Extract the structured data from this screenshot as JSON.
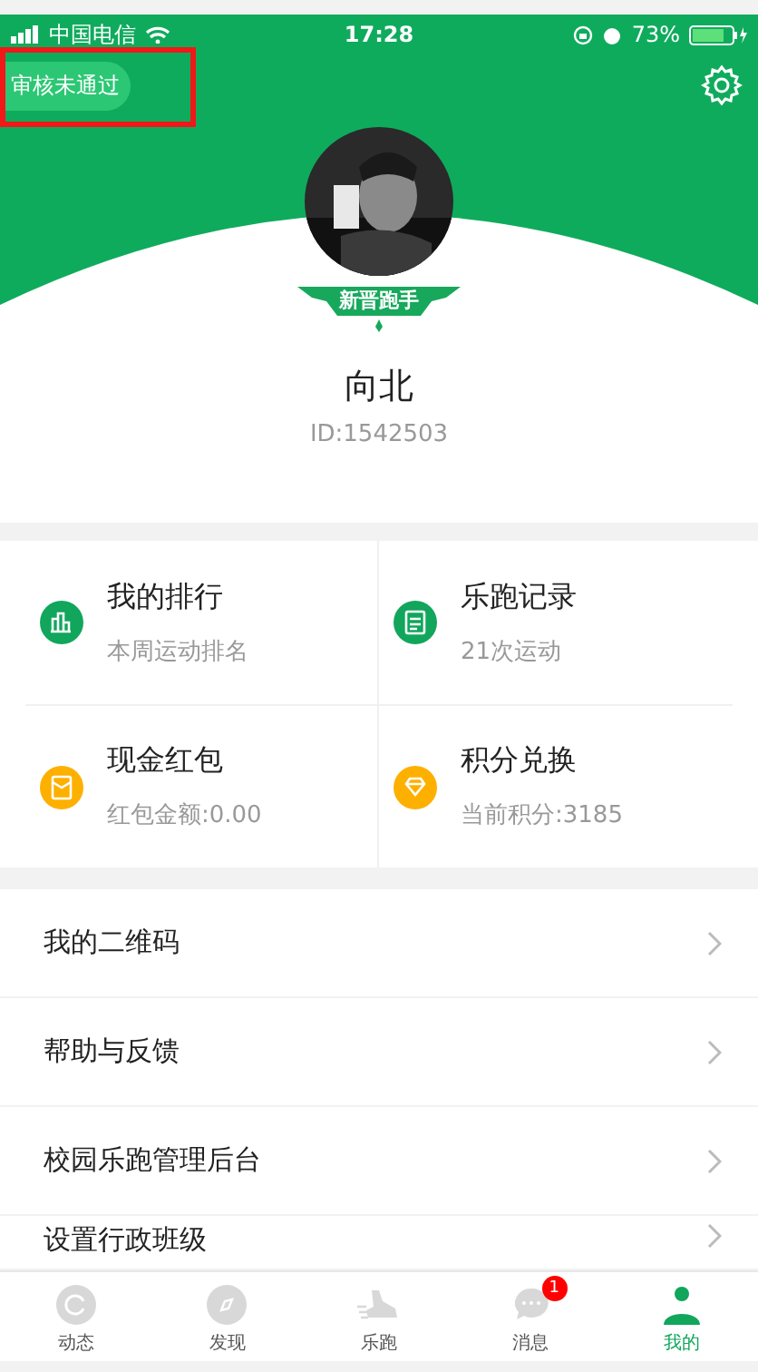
{
  "status_bar": {
    "carrier": "中国电信",
    "time": "17:28",
    "battery": "73%"
  },
  "header": {
    "review_status": "审核未通过",
    "highlighted": true
  },
  "profile": {
    "badge": "新晋跑手",
    "name": "向北",
    "id": "ID:1542503"
  },
  "stats": [
    {
      "kind": "ranking",
      "title": "我的排行",
      "subtitle": "本周运动排名",
      "color": "#11a65c"
    },
    {
      "kind": "record",
      "title": "乐跑记录",
      "subtitle": "21次运动",
      "color": "#11a65c"
    },
    {
      "kind": "wallet",
      "title": "现金红包",
      "subtitle": "红包金额:0.00",
      "color": "#fdb000"
    },
    {
      "kind": "points",
      "title": "积分兑换",
      "subtitle": "当前积分:3185",
      "color": "#fdb000"
    }
  ],
  "menu": [
    "我的二维码",
    "帮助与反馈",
    "校园乐跑管理后台",
    "设置行政班级"
  ],
  "tabs": [
    {
      "kind": "feed",
      "label": "动态",
      "selected": false
    },
    {
      "kind": "discover",
      "label": "发现",
      "selected": false
    },
    {
      "kind": "run",
      "label": "乐跑",
      "selected": false
    },
    {
      "kind": "messages",
      "label": "消息",
      "selected": false,
      "badge": "1"
    },
    {
      "kind": "me",
      "label": "我的",
      "selected": true
    }
  ]
}
